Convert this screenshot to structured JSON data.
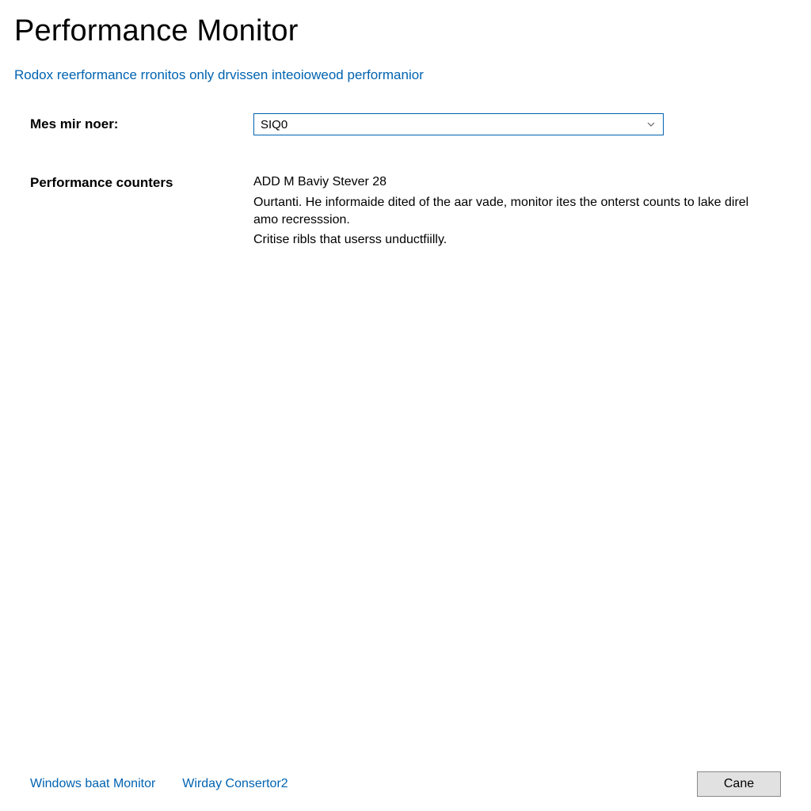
{
  "header": {
    "title": "Performance Monitor",
    "subtitle": "Rodox reerformance rronitos only drvissen inteoioweod performanior"
  },
  "form": {
    "moner_label": "Mes mir noer:",
    "moner_value": "SIQ0"
  },
  "counters": {
    "label": "Performance counters",
    "line1": "ADD M Baviy Stever 28",
    "para1": "Ourtanti. He informaide dited of the aar vade, monitor ites the onterst counts to lake direl amo recresssion.",
    "para2": "Critise ribls that userss unductfiilly."
  },
  "footer": {
    "link1": "Windows baat Monitor",
    "link2": "Wirday Consertor2",
    "cancel": "Cane"
  }
}
